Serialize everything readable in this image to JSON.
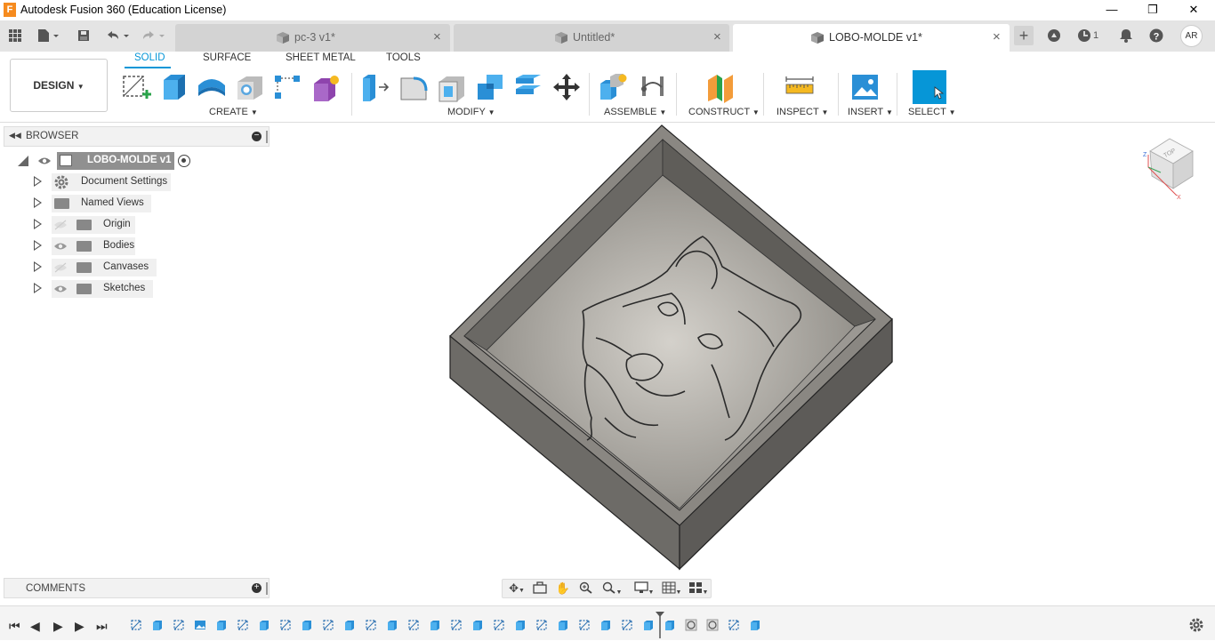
{
  "app": {
    "title": "Autodesk Fusion 360 (Education License)",
    "logo_letter": "F"
  },
  "window_controls": {
    "minimize": "—",
    "restore": "❐",
    "close": "✕"
  },
  "tabs": [
    {
      "label": "pc-3 v1*",
      "active": false
    },
    {
      "label": "Untitled*",
      "active": false
    },
    {
      "label": "LOBO-MOLDE v1*",
      "active": true
    }
  ],
  "header_right": {
    "job_count": "1",
    "user_initials": "AR"
  },
  "toolbar": {
    "workspace_button": "DESIGN",
    "workspace_tabs": [
      "SOLID",
      "SURFACE",
      "SHEET METAL",
      "TOOLS"
    ],
    "groups": [
      "CREATE",
      "MODIFY",
      "ASSEMBLE",
      "CONSTRUCT",
      "INSPECT",
      "INSERT",
      "SELECT"
    ]
  },
  "browser": {
    "title": "BROWSER",
    "root": "LOBO-MOLDE v1",
    "items": [
      {
        "label": "Document Settings",
        "icon": "gear-icon"
      },
      {
        "label": "Named Views",
        "icon": "folder-icon"
      },
      {
        "label": "Origin",
        "icon": "folder-icon",
        "hidden": true
      },
      {
        "label": "Bodies",
        "icon": "folder-icon"
      },
      {
        "label": "Canvases",
        "icon": "folder-icon",
        "hidden": true
      },
      {
        "label": "Sketches",
        "icon": "folder-icon"
      }
    ]
  },
  "comments": {
    "title": "COMMENTS"
  },
  "viewcube": {
    "face": "TOP"
  },
  "colors": {
    "accent": "#0696d7",
    "select_active": "#0696d7",
    "model": "#8a8782"
  }
}
